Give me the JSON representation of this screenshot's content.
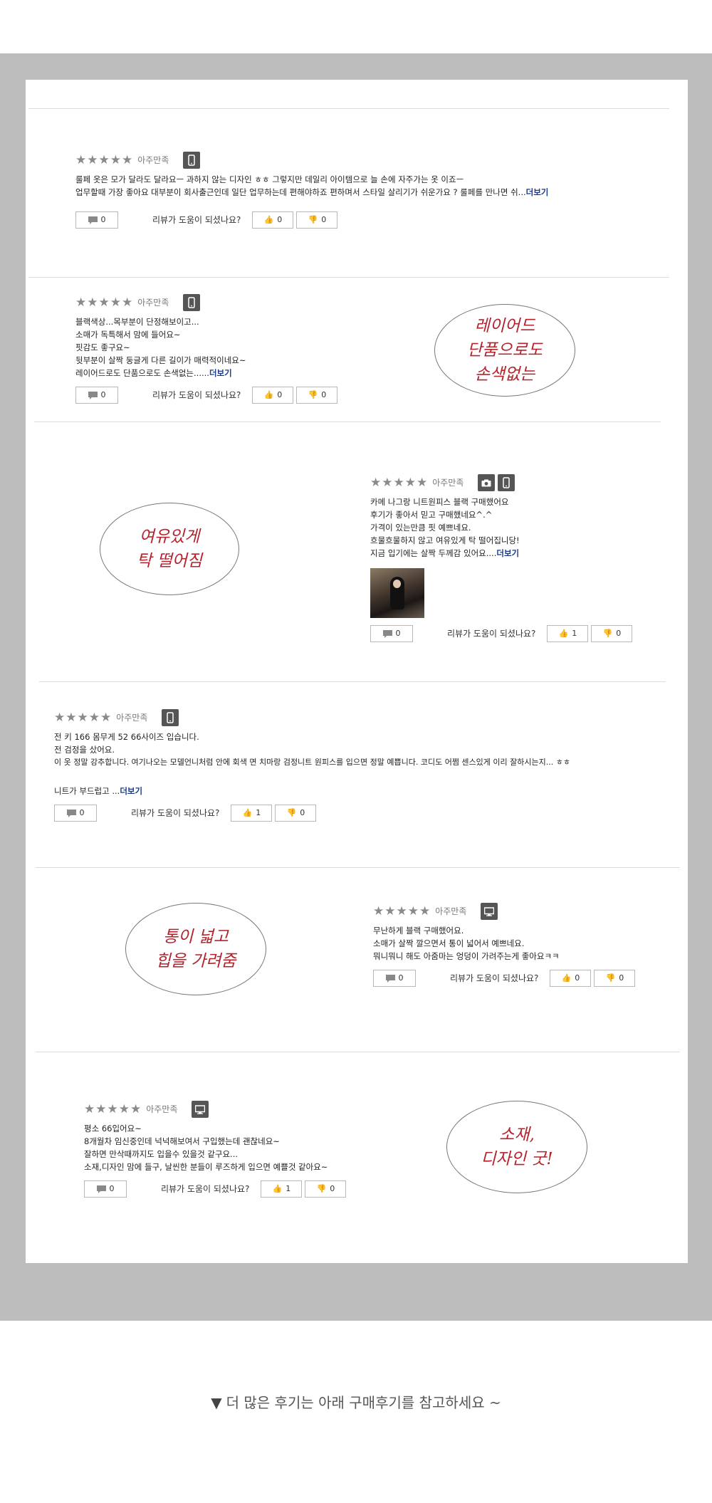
{
  "grade_label": "아주만족",
  "helpful_question": "리뷰가 도움이 되셨나요?",
  "more_label": "더보기",
  "reviews": [
    {
      "lines": [
        "룰페 옷은 모가 달라도 달라요ㅡ 과하지 않는 디자인 ㅎㅎ 그렇지만 데일리 아이템으로 늘 손에 자주가는 옷 이죠ㅡ",
        "업무할때 가장 좋아요 대부분이 회사출근인데 일단 업무하는데 편해야하죠 편하며서 스타일 살리기가 쉬운가요 ? 룰페를 만나면 쉬..."
      ],
      "comments": "0",
      "up": "0",
      "down": "0"
    },
    {
      "lines": [
        "블랙색상...목부분이 단정해보이고...",
        "소매가 독특해서 맘에 들어요~",
        "핏감도 좋구요~",
        "뒷부분이 살짝 둥글게 다른 길이가 매력적이네요~",
        "레이어드로도 단품으로도 손색없는......"
      ],
      "comments": "0",
      "up": "0",
      "down": "0"
    },
    {
      "lines": [
        "카메 나그랑 니트원피스 블랙 구매했어요",
        "후기가 좋아서 믿고 구매했네요^.^",
        "가격이 있는만큼 핏 예쁘네요.",
        "흐물흐물하지 않고 여유있게 탁 떨어집니당!",
        "지금 입기에는 살짝 두께감 있어요...."
      ],
      "comments": "0",
      "up": "1",
      "down": "0"
    },
    {
      "lines": [
        "전 키 166 몸무게 52 66사이즈 입습니다.",
        "전 검정을 샀어요.",
        "이 옷 정말 강추합니다. 여기나오는 모델언니처럼 안에 회색 면 치마랑 검정니트 원피스를 입으면 정말 예쁩니다. 코디도 어쩜 센스있게 이리 잘하시는지... ㅎㅎ",
        "",
        "니트가 부드럽고 ..."
      ],
      "comments": "0",
      "up": "1",
      "down": "0"
    },
    {
      "lines": [
        "무난하게 블랙 구매했어요.",
        "소매가 살짝 깔으면서 통이 넓어서 예쁘네요.",
        "뭐니뭐니 해도 아줌마는 엉덩이 가려주는게 좋아요ㅋㅋ"
      ],
      "comments": "0",
      "up": "0",
      "down": "0"
    },
    {
      "lines": [
        "평소 66입어요~",
        "8개월차 임신중인데 넉넉해보여서 구입했는데 괜찮네요~",
        "잘하면 만삭때까지도 입을수 있을것 같구요...",
        "소재,디자인 맘에 들구, 날씬한 분들이 루즈하게 입으면 예쁠것 같아요~"
      ],
      "comments": "0",
      "up": "1",
      "down": "0"
    }
  ],
  "callouts": [
    "레이어드\n단품으로도\n손색없는",
    "여유있게\n탁 떨어짐",
    "통이 넓고\n힙을 가려줌",
    "소재,\n디자인 굿!"
  ],
  "footer_text": "더 많은 후기는 아래 구매후기를 참고하세요 ~",
  "icons": [
    "star-icon",
    "mobile-icon",
    "camera-icon",
    "monitor-icon",
    "comment-icon",
    "thumb-up-icon",
    "thumb-down-icon",
    "triangle-down-icon"
  ]
}
